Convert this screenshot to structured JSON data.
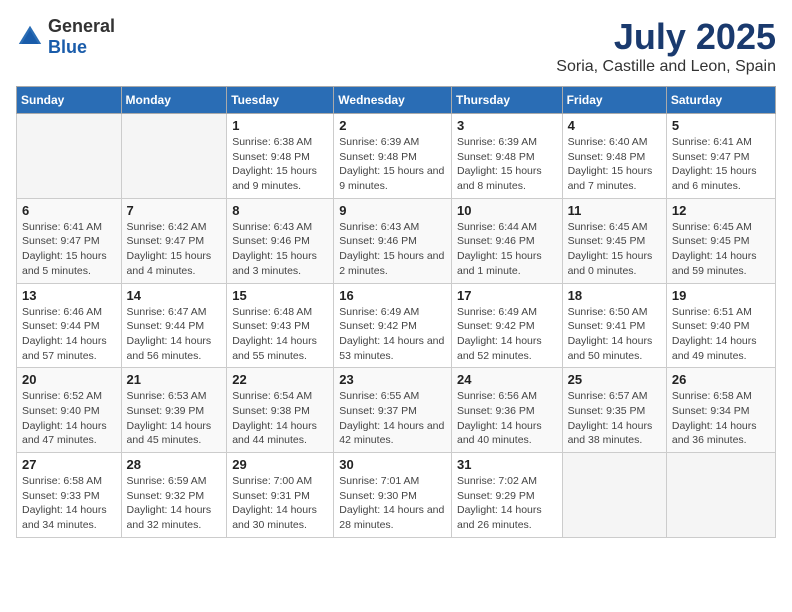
{
  "logo": {
    "general": "General",
    "blue": "Blue"
  },
  "title": "July 2025",
  "subtitle": "Soria, Castille and Leon, Spain",
  "weekdays": [
    "Sunday",
    "Monday",
    "Tuesday",
    "Wednesday",
    "Thursday",
    "Friday",
    "Saturday"
  ],
  "weeks": [
    [
      {
        "day": "",
        "info": ""
      },
      {
        "day": "",
        "info": ""
      },
      {
        "day": "1",
        "info": "Sunrise: 6:38 AM\nSunset: 9:48 PM\nDaylight: 15 hours and 9 minutes."
      },
      {
        "day": "2",
        "info": "Sunrise: 6:39 AM\nSunset: 9:48 PM\nDaylight: 15 hours and 9 minutes."
      },
      {
        "day": "3",
        "info": "Sunrise: 6:39 AM\nSunset: 9:48 PM\nDaylight: 15 hours and 8 minutes."
      },
      {
        "day": "4",
        "info": "Sunrise: 6:40 AM\nSunset: 9:48 PM\nDaylight: 15 hours and 7 minutes."
      },
      {
        "day": "5",
        "info": "Sunrise: 6:41 AM\nSunset: 9:47 PM\nDaylight: 15 hours and 6 minutes."
      }
    ],
    [
      {
        "day": "6",
        "info": "Sunrise: 6:41 AM\nSunset: 9:47 PM\nDaylight: 15 hours and 5 minutes."
      },
      {
        "day": "7",
        "info": "Sunrise: 6:42 AM\nSunset: 9:47 PM\nDaylight: 15 hours and 4 minutes."
      },
      {
        "day": "8",
        "info": "Sunrise: 6:43 AM\nSunset: 9:46 PM\nDaylight: 15 hours and 3 minutes."
      },
      {
        "day": "9",
        "info": "Sunrise: 6:43 AM\nSunset: 9:46 PM\nDaylight: 15 hours and 2 minutes."
      },
      {
        "day": "10",
        "info": "Sunrise: 6:44 AM\nSunset: 9:46 PM\nDaylight: 15 hours and 1 minute."
      },
      {
        "day": "11",
        "info": "Sunrise: 6:45 AM\nSunset: 9:45 PM\nDaylight: 15 hours and 0 minutes."
      },
      {
        "day": "12",
        "info": "Sunrise: 6:45 AM\nSunset: 9:45 PM\nDaylight: 14 hours and 59 minutes."
      }
    ],
    [
      {
        "day": "13",
        "info": "Sunrise: 6:46 AM\nSunset: 9:44 PM\nDaylight: 14 hours and 57 minutes."
      },
      {
        "day": "14",
        "info": "Sunrise: 6:47 AM\nSunset: 9:44 PM\nDaylight: 14 hours and 56 minutes."
      },
      {
        "day": "15",
        "info": "Sunrise: 6:48 AM\nSunset: 9:43 PM\nDaylight: 14 hours and 55 minutes."
      },
      {
        "day": "16",
        "info": "Sunrise: 6:49 AM\nSunset: 9:42 PM\nDaylight: 14 hours and 53 minutes."
      },
      {
        "day": "17",
        "info": "Sunrise: 6:49 AM\nSunset: 9:42 PM\nDaylight: 14 hours and 52 minutes."
      },
      {
        "day": "18",
        "info": "Sunrise: 6:50 AM\nSunset: 9:41 PM\nDaylight: 14 hours and 50 minutes."
      },
      {
        "day": "19",
        "info": "Sunrise: 6:51 AM\nSunset: 9:40 PM\nDaylight: 14 hours and 49 minutes."
      }
    ],
    [
      {
        "day": "20",
        "info": "Sunrise: 6:52 AM\nSunset: 9:40 PM\nDaylight: 14 hours and 47 minutes."
      },
      {
        "day": "21",
        "info": "Sunrise: 6:53 AM\nSunset: 9:39 PM\nDaylight: 14 hours and 45 minutes."
      },
      {
        "day": "22",
        "info": "Sunrise: 6:54 AM\nSunset: 9:38 PM\nDaylight: 14 hours and 44 minutes."
      },
      {
        "day": "23",
        "info": "Sunrise: 6:55 AM\nSunset: 9:37 PM\nDaylight: 14 hours and 42 minutes."
      },
      {
        "day": "24",
        "info": "Sunrise: 6:56 AM\nSunset: 9:36 PM\nDaylight: 14 hours and 40 minutes."
      },
      {
        "day": "25",
        "info": "Sunrise: 6:57 AM\nSunset: 9:35 PM\nDaylight: 14 hours and 38 minutes."
      },
      {
        "day": "26",
        "info": "Sunrise: 6:58 AM\nSunset: 9:34 PM\nDaylight: 14 hours and 36 minutes."
      }
    ],
    [
      {
        "day": "27",
        "info": "Sunrise: 6:58 AM\nSunset: 9:33 PM\nDaylight: 14 hours and 34 minutes."
      },
      {
        "day": "28",
        "info": "Sunrise: 6:59 AM\nSunset: 9:32 PM\nDaylight: 14 hours and 32 minutes."
      },
      {
        "day": "29",
        "info": "Sunrise: 7:00 AM\nSunset: 9:31 PM\nDaylight: 14 hours and 30 minutes."
      },
      {
        "day": "30",
        "info": "Sunrise: 7:01 AM\nSunset: 9:30 PM\nDaylight: 14 hours and 28 minutes."
      },
      {
        "day": "31",
        "info": "Sunrise: 7:02 AM\nSunset: 9:29 PM\nDaylight: 14 hours and 26 minutes."
      },
      {
        "day": "",
        "info": ""
      },
      {
        "day": "",
        "info": ""
      }
    ]
  ]
}
